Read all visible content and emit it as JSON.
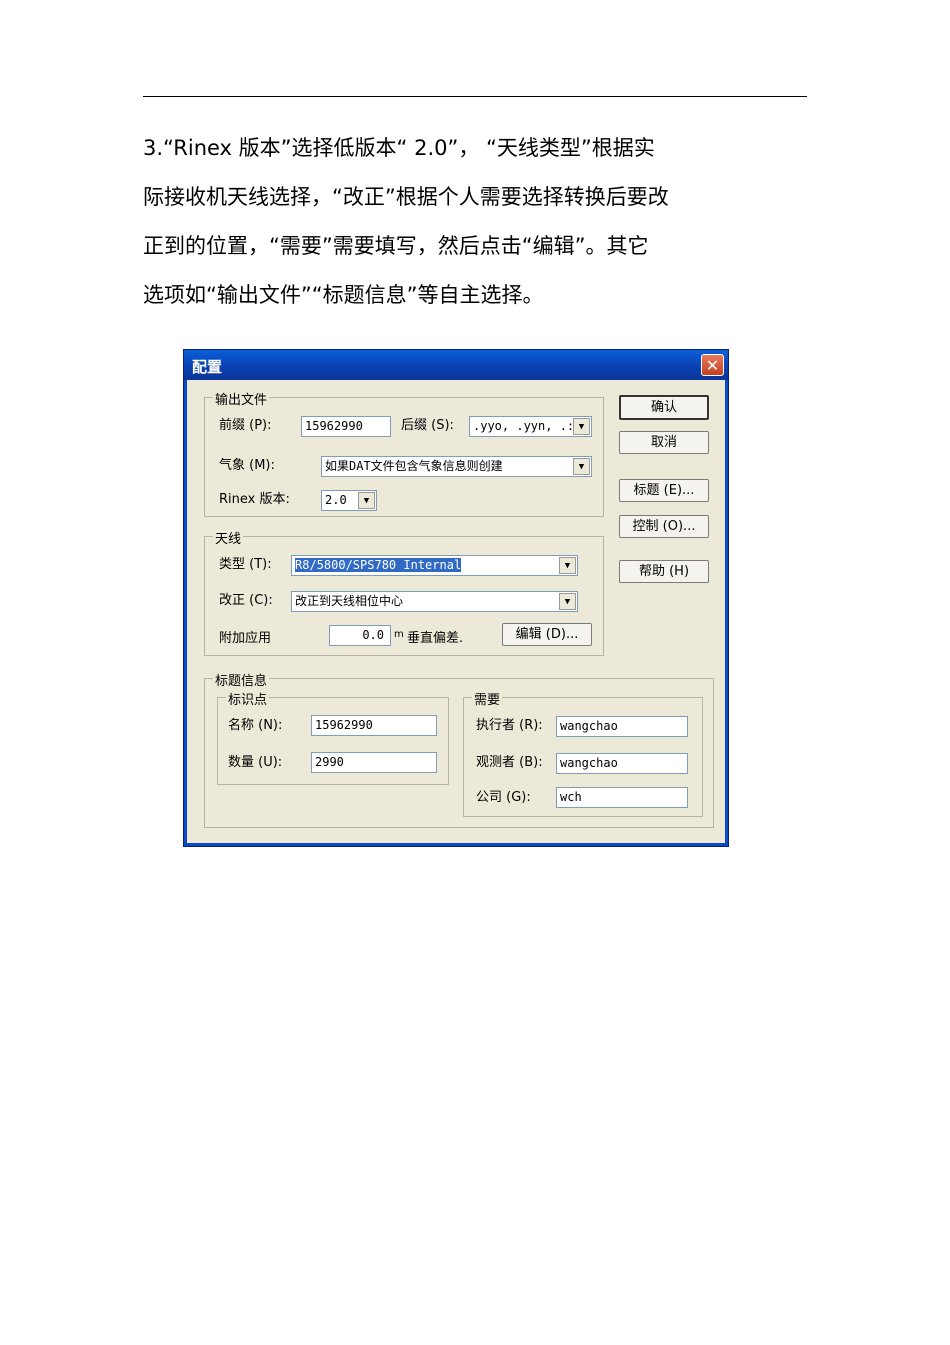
{
  "paragraph": {
    "lines": [
      "3.“Rinex  版本”选择低版本“   2.0”， “天线类型”根据实",
      "际接收机天线选择，“改正”根据个人需要选择转换后要改",
      "正到的位置，“需要”需要填写，然后点击“编辑”。其它",
      "选项如“输出文件”“标题信息”等自主选择。"
    ]
  },
  "dialog": {
    "title": "配置",
    "close": "✕",
    "output_group": {
      "title": "输出文件",
      "prefix_label": "前缀 (P):",
      "prefix_value": "15962990",
      "suffix_label": "后缀 (S):",
      "suffix_value": ".yyo, .yyn, .:",
      "weather_label": "气象 (M):",
      "weather_value": "如果DAT文件包含气象信息则创建",
      "rinex_label": "Rinex 版本:",
      "rinex_value": "2.0"
    },
    "antenna_group": {
      "title": "天线",
      "type_label": "类型 (T):",
      "type_value": "R8/5800/SPS780 Internal",
      "correction_label": "改正 (C):",
      "correction_value": "改正到天线相位中心",
      "apply_label": "附加应用",
      "offset_value": "0.0",
      "offset_unit": "m",
      "offset_label": "垂直偏差.",
      "edit_button": "编辑 (D)..."
    },
    "buttons": {
      "ok": "确认",
      "cancel": "取消",
      "header": "标题 (E)...",
      "control": "控制 (O)...",
      "help": "帮助 (H)"
    },
    "header_group": {
      "title": "标题信息",
      "mark_group": {
        "title": "标识点",
        "name_label": "名称 (N):",
        "name_value": "15962990",
        "number_label": "数量 (U):",
        "number_value": "2990"
      },
      "required_group": {
        "title": "需要",
        "operator_label": "执行者 (R):",
        "operator_value": "wangchao",
        "observer_label": "观测者 (B):",
        "observer_value": "wangchao",
        "company_label": "公司 (G):",
        "company_value": "wch"
      }
    }
  }
}
